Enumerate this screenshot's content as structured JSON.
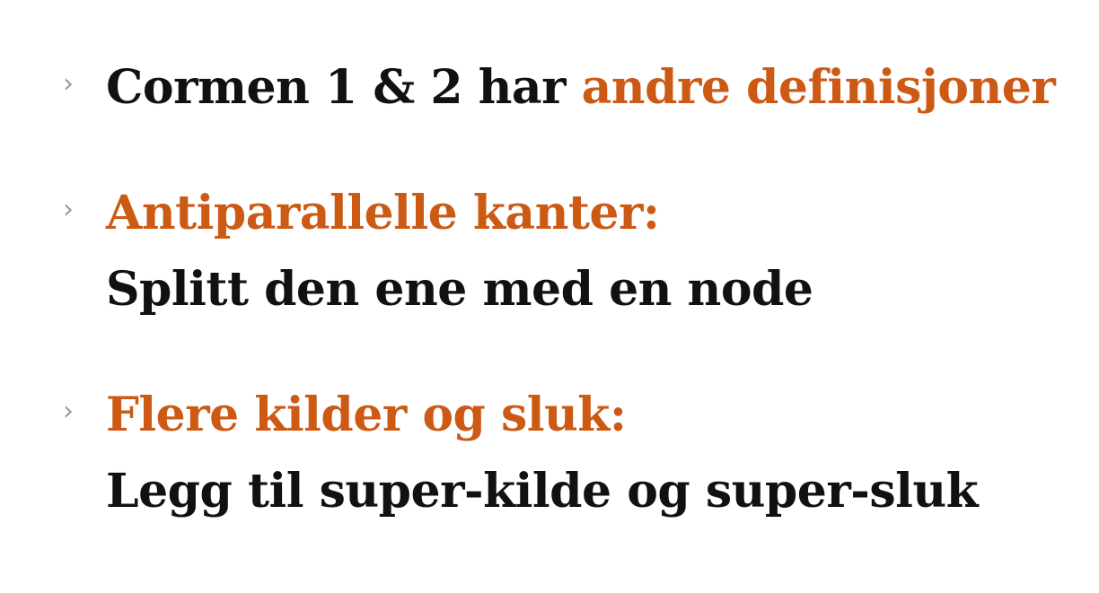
{
  "bullets": [
    {
      "marker": "›",
      "lead": "Cormen 1 & 2 har ",
      "accent": "andre definisjoner"
    },
    {
      "marker": "›",
      "heading": "Antiparallelle kanter:",
      "detail": "Splitt den ene med en node"
    },
    {
      "marker": "›",
      "heading": "Flere kilder og sluk:",
      "detail": "Legg til super-kilde og super-sluk"
    }
  ],
  "colors": {
    "accent": "#cc5a14",
    "text": "#111111",
    "marker": "#9a9a9a",
    "background": "#ffffff"
  }
}
